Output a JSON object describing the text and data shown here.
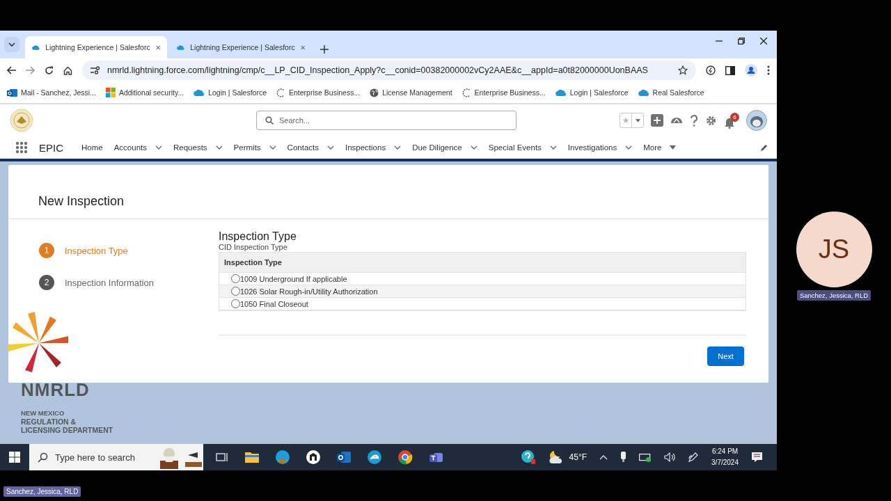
{
  "browser": {
    "tabs": [
      {
        "title": "Lightning Experience | Salesforc",
        "selected": true
      },
      {
        "title": "Lightning Experience | Salesforc",
        "selected": false
      }
    ],
    "url": "nmrld.lightning.force.com/lightning/cmp/c__LP_CID_Inspection_Apply?c__conid=00382000002vCy2AAE&c__appId=a0t82000000UonBAAS",
    "bookmarks": [
      {
        "label": "Mail - Sanchez, Jessi...",
        "kind": "mail"
      },
      {
        "label": "Additional security...",
        "kind": "windows"
      },
      {
        "label": "Login | Salesforce",
        "kind": "cloud"
      },
      {
        "label": "Enterprise Business...",
        "kind": "spinner"
      },
      {
        "label": "License Management",
        "kind": "globe"
      },
      {
        "label": "Enterprise Business...",
        "kind": "spinner"
      },
      {
        "label": "Login | Salesforce",
        "kind": "cloud"
      },
      {
        "label": "Real Salesforce",
        "kind": "cloud"
      }
    ]
  },
  "header": {
    "search_placeholder": "Search...",
    "notification_count": "6"
  },
  "nav": {
    "app_name": "EPIC",
    "items": [
      {
        "label": "Home",
        "kind": "plain"
      },
      {
        "label": "Accounts",
        "kind": "dropdown"
      },
      {
        "label": "Requests",
        "kind": "dropdown"
      },
      {
        "label": "Permits",
        "kind": "dropdown"
      },
      {
        "label": "Contacts",
        "kind": "dropdown"
      },
      {
        "label": "Inspections",
        "kind": "dropdown"
      },
      {
        "label": "Due Diligence",
        "kind": "dropdown"
      },
      {
        "label": "Special Events",
        "kind": "dropdown"
      },
      {
        "label": "Investigations",
        "kind": "dropdown"
      },
      {
        "label": "More",
        "kind": "more"
      }
    ]
  },
  "page": {
    "title": "New Inspection",
    "steps": [
      {
        "number": "1",
        "label": "Inspection Type",
        "selected": true
      },
      {
        "number": "2",
        "label": "Inspection Information",
        "selected": false
      }
    ],
    "section_title": "Inspection Type",
    "section_subtitle": "CID Inspection Type",
    "table": {
      "column": "Inspection Type",
      "rows": [
        {
          "label": "1009 Underground If applicable",
          "selected": false,
          "highlighted": false
        },
        {
          "label": "1026 Solar Rough-in/Utility Authorization",
          "selected": false,
          "highlighted": true
        },
        {
          "label": "1050 Final Closeout",
          "selected": false,
          "highlighted": false
        }
      ]
    },
    "next_button": "Next"
  },
  "logo": {
    "name": "NMRLD",
    "lines": [
      "NEW MEXICO",
      "REGULATION &",
      "LICENSING DEPARTMENT"
    ]
  },
  "taskbar": {
    "search_placeholder": "Type here to search",
    "temperature": "45°F",
    "time": "6:24 PM",
    "date": "3/7/2024"
  },
  "call": {
    "initials": "JS",
    "tile_name": "Sanchez, Jessica, RLD",
    "presenter_name": "Sanchez, Jessica, RLD"
  }
}
